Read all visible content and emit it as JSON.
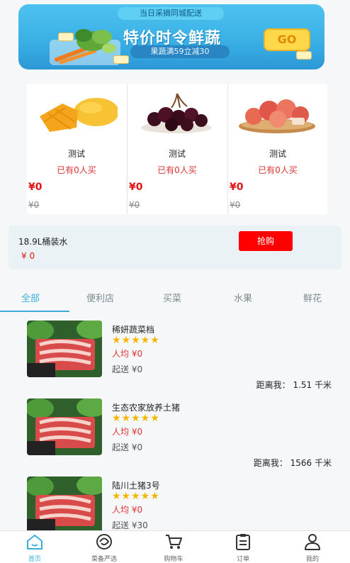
{
  "banner": {
    "tag": "当日采摘同城配送",
    "title": "特价时令鲜蔬",
    "subtitle": "果蔬满59立减30",
    "go_label": "GO"
  },
  "products": [
    {
      "name": "测试",
      "buyers": "已有0人买",
      "price": "¥0",
      "old_price": "¥0",
      "image": "mango"
    },
    {
      "name": "测试",
      "buyers": "已有0人买",
      "price": "¥0",
      "old_price": "¥0",
      "image": "cherries"
    },
    {
      "name": "测试",
      "buyers": "已有0人买",
      "price": "¥0",
      "old_price": "¥0",
      "image": "apples"
    }
  ],
  "promo": {
    "name": "18.9L桶装水",
    "price": "¥ 0",
    "buy_label": "抢购"
  },
  "tabs": [
    "全部",
    "便利店",
    "买菜",
    "水果",
    "鲜花"
  ],
  "stores": [
    {
      "name": "稀妍蔬菜档",
      "stars": "★★★★★",
      "avg": "人均 ¥0",
      "min_fee": "起送 ¥0",
      "distance": "距离我： 1.51 千米"
    },
    {
      "name": "生态农家放养土猪",
      "stars": "★★★★★",
      "avg": "人均 ¥0",
      "min_fee": "起送 ¥0",
      "distance": "距离我： 1566 千米"
    },
    {
      "name": "陆川土猪3号",
      "stars": "★★★★★",
      "avg": "人均 ¥0",
      "min_fee": "起送 ¥30",
      "distance": ""
    }
  ],
  "bottom_nav": [
    {
      "label": "首页",
      "icon": "home-icon"
    },
    {
      "label": "菜备严选",
      "icon": "selection-icon"
    },
    {
      "label": "购物车",
      "icon": "cart-icon"
    },
    {
      "label": "订单",
      "icon": "order-icon"
    },
    {
      "label": "我的",
      "icon": "user-icon"
    }
  ],
  "colors": {
    "accent": "#3aaed8",
    "price_red": "#e01515",
    "buy_button": "#ff0000",
    "star": "#f5b400"
  }
}
